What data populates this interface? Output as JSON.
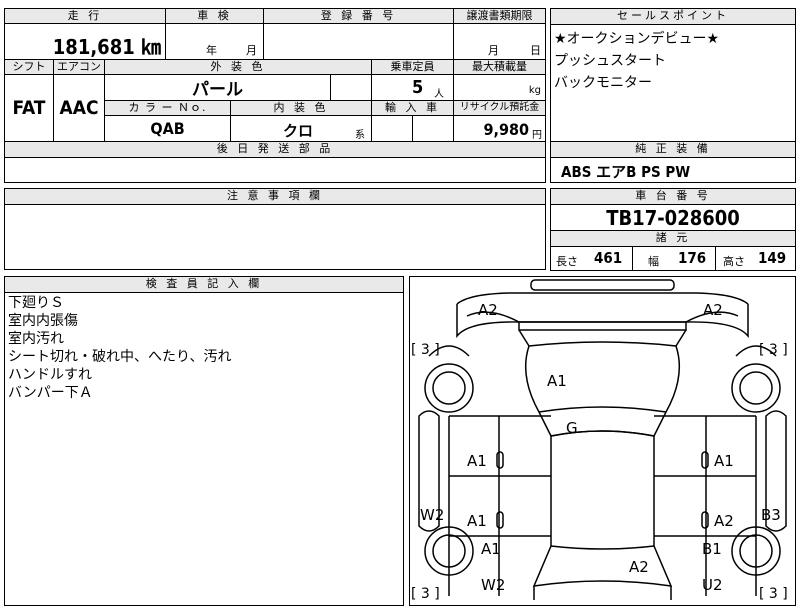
{
  "top_table": {
    "h_mileage": "走 行",
    "h_inspection": "車 検",
    "h_registration": "登 録 番 号",
    "h_transfer_deadline": "譲渡書類期限",
    "mileage": "181,681 ㎞",
    "inspection_year_unit": "年",
    "inspection_month_unit": "月",
    "transfer_month_unit": "月",
    "transfer_day_unit": "日",
    "h_shift": "シフト",
    "h_aircon": "エアコン",
    "h_exterior_color": "外 装 色",
    "h_capacity": "乗車定員",
    "h_max_load": "最大積載量",
    "shift": "FAT",
    "aircon": "AAC",
    "exterior_color": "パール",
    "capacity": "5",
    "capacity_unit": "人",
    "load_unit": "kg",
    "h_color_no": "カ ラ ー Ｎｏ.",
    "h_interior_color": "内 装 色",
    "h_import": "輸 入 車",
    "h_recycle": "リサイクル預託金",
    "color_no": "QAB",
    "interior_color": "クロ",
    "interior_suffix": "系",
    "recycle_fee": "9,980",
    "recycle_unit": "円",
    "h_delivery_parts": "後 日 発 送 部 品"
  },
  "sales_points": {
    "header": "セールスポイント",
    "items": [
      "★オークションデビュー★",
      "プッシュスタート",
      "バックモニター"
    ]
  },
  "genuine_equipment": {
    "header": "純 正 装 備",
    "value": "ABS エアB PS PW"
  },
  "notes": {
    "header": "注 意 事 項 欄"
  },
  "chassis": {
    "header": "車 台 番 号",
    "value": "TB17-028600"
  },
  "specs": {
    "header": "諸 元",
    "length_label": "長さ",
    "length": "461",
    "width_label": "幅",
    "width": "176",
    "height_label": "高さ",
    "height": "149"
  },
  "inspector": {
    "header": "検 査 員 記 入 欄",
    "lines": [
      "下廻りＳ",
      "室内内張傷",
      "室内汚れ",
      "シート切れ・破れ中、へたり、汚れ",
      "ハンドルすれ",
      "バンパー下Ａ"
    ]
  },
  "diagram": {
    "tread_left_top": "[ 3 ]",
    "tread_right_top": "[ 3 ]",
    "tread_left_bottom": "[ 3 ]",
    "tread_right_bottom": "[ 3 ]",
    "marks": {
      "front_left": "A2",
      "front_right": "A2",
      "bonnet": "A1",
      "roof": "G",
      "front_door_left": "A1",
      "front_door_right": "A1",
      "rear_door_left": "A1",
      "rear_door_right": "A2",
      "left_side": "W2",
      "right_side": "B3",
      "rear_fender_left": "A1",
      "rear_fender_right": "B1",
      "rear_quarter_left": "W2",
      "rear_quarter_right": "U2",
      "trunk": "A2"
    }
  }
}
